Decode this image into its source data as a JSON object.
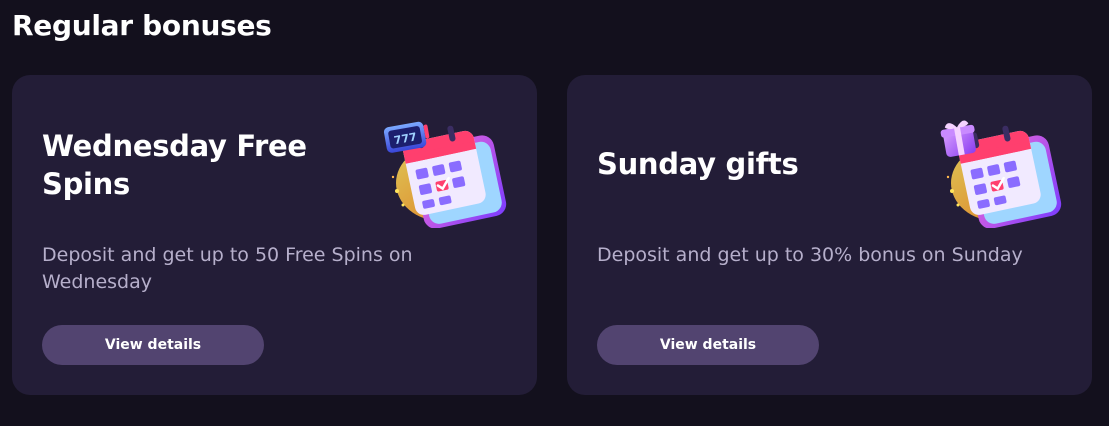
{
  "section": {
    "title": "Regular bonuses"
  },
  "cards": [
    {
      "title": "Wednesday Free Spins",
      "description": "Deposit and get up to 50 Free Spins on Wednesday",
      "button_label": "View details",
      "icon": "calendar-slot-icon",
      "slot_text": "777"
    },
    {
      "title": "Sunday gifts",
      "description": "Deposit and get up to 30% bonus on Sunday",
      "button_label": "View details",
      "icon": "calendar-gift-icon"
    }
  ],
  "colors": {
    "page_bg": "#13101d",
    "card_bg": "#231d37",
    "button_bg": "#524470",
    "description_text": "#b6afcb",
    "title_text": "#ffffff"
  }
}
